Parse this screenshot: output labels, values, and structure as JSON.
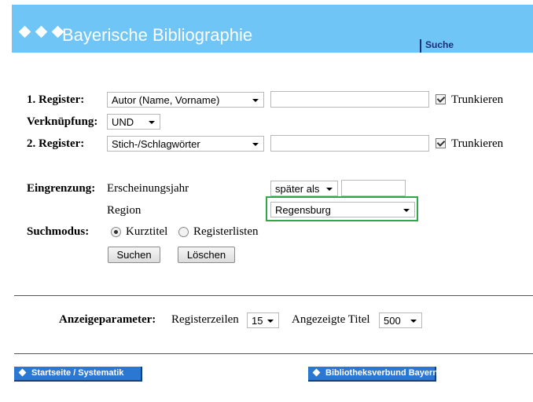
{
  "header": {
    "title": "Bayerische Bibliographie",
    "nav_link": "Suche",
    "background": "#6fc6f6"
  },
  "search": {
    "register1": {
      "label": "1. Register:",
      "selected": "Autor (Name, Vorname)",
      "value": "",
      "truncate_label": "Trunkieren",
      "truncate_checked": true
    },
    "link": {
      "label": "Verknüpfung:",
      "selected": "UND"
    },
    "register2": {
      "label": "2. Register:",
      "selected": "Stich-/Schlagwörter",
      "value": "",
      "truncate_label": "Trunkieren",
      "truncate_checked": true
    }
  },
  "restriction": {
    "label": "Eingrenzung:",
    "year_label": "Erscheinungsjahr",
    "year_operator": "später als",
    "year_value": "",
    "region_label": "Region",
    "region_selected": "Regensburg"
  },
  "mode": {
    "label": "Suchmodus:",
    "options": [
      "Kurztitel",
      "Registerlisten"
    ],
    "selected": "Kurztitel"
  },
  "buttons": {
    "search": "Suchen",
    "clear": "Löschen"
  },
  "display": {
    "label": "Anzeigeparameter:",
    "rows_label": "Registerzeilen",
    "rows_value": "15",
    "titles_label": "Angezeigte Titel",
    "titles_value": "500"
  },
  "footer": {
    "home_link": "Startseite / Systematik",
    "library_link": "Bibliotheksverbund Bayern",
    "button_color": "#2a78d2"
  }
}
